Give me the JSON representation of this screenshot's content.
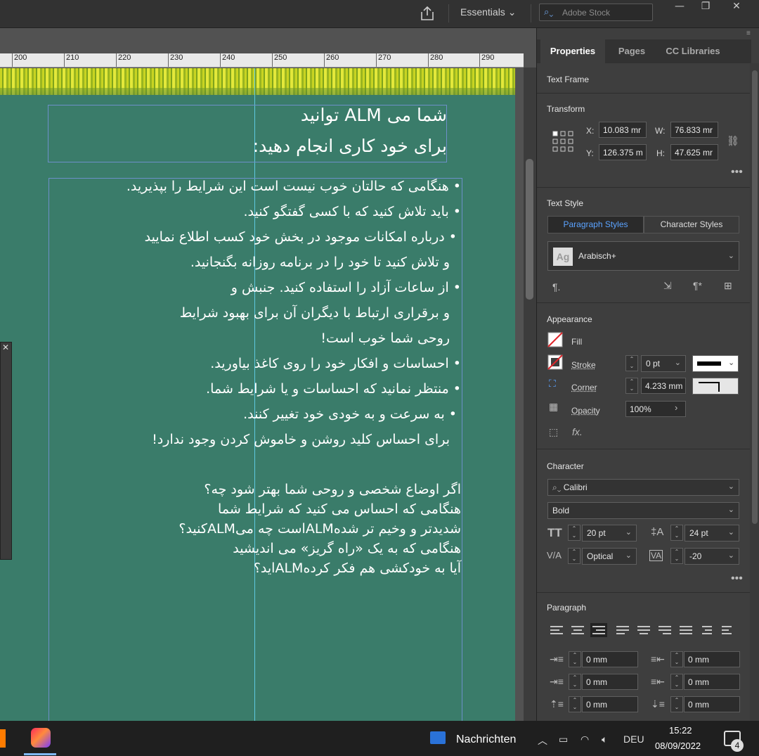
{
  "topbar": {
    "workspace": "Essentials",
    "search_placeholder": "Adobe Stock"
  },
  "ruler": {
    "ticks": [
      "200",
      "210",
      "220",
      "230",
      "240",
      "250",
      "260",
      "270",
      "280",
      "290"
    ]
  },
  "document": {
    "title_line1": "شما می ALM توانید",
    "title_line2": "برای خود کاری انجام دهید:",
    "bullets": [
      "• هنگامی که حالتان خوب نیست است این شرایط را بپذیرید.",
      "• باید تلاش کنید که با کسی گفتگو کنید.",
      "• درباره امکانات موجود در بخش خود کسب اطلاع نمایید",
      "و تلاش کنید تا خود را در برنامه روزانه بگنجانید.",
      "• از ساعات آزاد را استفاده کنید. جنبش و",
      "و برقراری ارتباط با دیگران آن برای بهبود شرایط",
      "روحی شما خوب است!",
      "• احساسات و افکار خود را روی کاغذ بیاورید.",
      "• منتظر نمانید که احساسات و یا شرایط شما.",
      "• به سرعت و به خودی خود تغییر کنند.",
      "برای احساس کلید روشن و خاموش کردن وجود ندارد!"
    ],
    "questions": [
      "اگر اوضاع شخصی و روحی شما بهتر شود چه؟",
      "هنگامی که احساس می کنید که شرایط شما",
      "شدیدتر و وخیم تر شدهALMاست چه میALMکنید؟",
      "هنگامی که به یک «راه گریز» می اندیشید",
      "آیا به خودکشی هم فکر کردهALMاید؟"
    ]
  },
  "panel": {
    "tabs": [
      "Properties",
      "Pages",
      "CC Libraries"
    ],
    "text_frame": "Text Frame",
    "transform": {
      "title": "Transform",
      "x_label": "X:",
      "x": "10.083 mr",
      "y_label": "Y:",
      "y": "126.375 m",
      "w_label": "W:",
      "w": "76.833 mr",
      "h_label": "H:",
      "h": "47.625 mr"
    },
    "text_style": {
      "title": "Text Style",
      "paragraph_styles": "Paragraph Styles",
      "character_styles": "Character Styles",
      "style_name": "Arabisch+",
      "style_icon": "Ag"
    },
    "appearance": {
      "title": "Appearance",
      "fill": "Fill",
      "stroke": "Stroke",
      "stroke_value": "0 pt",
      "corner": "Corner",
      "corner_value": "4.233 mm",
      "opacity": "Opacity",
      "opacity_value": "100%"
    },
    "character": {
      "title": "Character",
      "font": "Calibri",
      "style": "Bold",
      "size": "20 pt",
      "leading": "24 pt",
      "kerning": "Optical",
      "tracking": "-20"
    },
    "paragraph": {
      "title": "Paragraph",
      "left_indent": "0 mm",
      "right_indent": "0 mm",
      "first_line": "0 mm",
      "last_line": "0 mm",
      "space_before": "0 mm",
      "space_after": "0 mm"
    }
  },
  "taskbar": {
    "news": "Nachrichten",
    "lang": "DEU",
    "time": "15:22",
    "date": "08/09/2022",
    "notifications": "4"
  }
}
